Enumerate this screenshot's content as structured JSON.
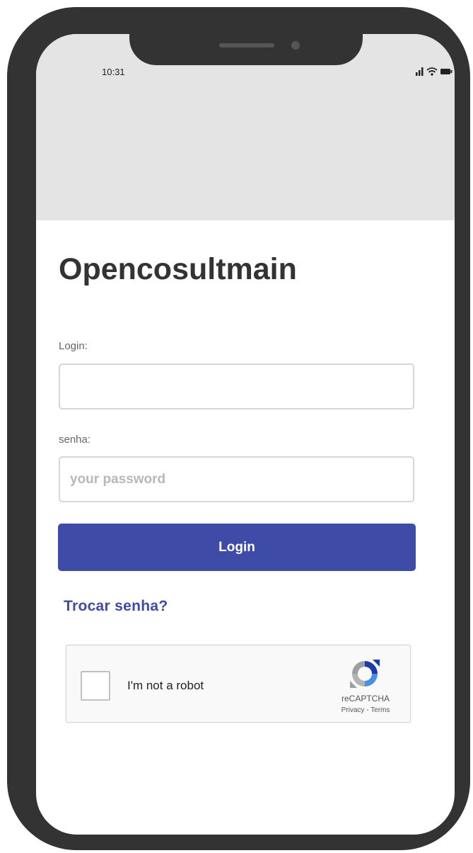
{
  "status_bar": {
    "time": "10:31",
    "icons": [
      "signal-icon",
      "wifi-icon",
      "battery-icon"
    ]
  },
  "app": {
    "title": "Opencosultmain"
  },
  "form": {
    "login_label": "Login:",
    "login_value": "",
    "login_placeholder": "",
    "password_label": "senha:",
    "password_value": "",
    "password_placeholder": "your password",
    "submit_label": "Login",
    "change_password_link": "Trocar senha?"
  },
  "recaptcha": {
    "label": "I'm not a robot",
    "brand": "reCAPTCHA",
    "privacy": "Privacy",
    "separator": " - ",
    "terms": "Terms",
    "checked": false
  },
  "colors": {
    "frame": "#333333",
    "header_background": "#e4e4e4",
    "accent": "#3e4ba7",
    "title_text": "#333333",
    "label_text": "#666666"
  }
}
